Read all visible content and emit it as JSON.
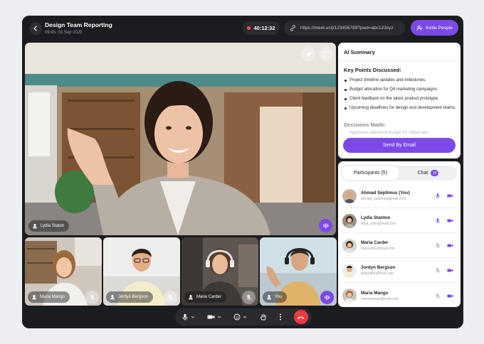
{
  "header": {
    "title": "Design Team Reporting",
    "datetime": "09:45, 03 Sep 2025",
    "timer": "40:12:32",
    "url": "https://meet.us/j/123456789?pwd=abc123xyz",
    "invite_label": "Invite People"
  },
  "main_video": {
    "name": "Lydia Staton"
  },
  "thumbnails": [
    {
      "name": "Maria Mango"
    },
    {
      "name": "Jordyn Bergson"
    },
    {
      "name": "Maria Carder"
    },
    {
      "name": "You"
    }
  ],
  "ai_summary": {
    "title": "AI Summary",
    "key_points_heading": "Key Points Discussed:",
    "key_points": [
      "Project timeline updates and milestones.",
      "Budget allocation for Q4 marketing campaigns.",
      "Client feedback on the latest product prototype.",
      "Upcoming deadlines for design and development teams."
    ],
    "decisions_heading": "Decisions Made:",
    "decisions_preview": "Approved additional budget for digital ads",
    "send_label": "Send By Email"
  },
  "participants_panel": {
    "tab_participants": "Participants (5)",
    "tab_chat": "Chat",
    "chat_count": "24",
    "participants": [
      {
        "name": "Ahmad Septimus  (You)",
        "email": "ahmad_septimus@mail.com"
      },
      {
        "name": "Lydia Stanton",
        "email": "lidya_stant@mail.com"
      },
      {
        "name": "Maria Carder",
        "email": "marcarder@mail.com"
      },
      {
        "name": "Jordyn Bergson",
        "email": "jordynber@mail.com"
      },
      {
        "name": "Maria Mango",
        "email": "mariamango@mail.com"
      }
    ]
  },
  "colors": {
    "accent": "#7b4ae6",
    "end_call": "#ee3b3b",
    "frame": "#1b1c20"
  }
}
